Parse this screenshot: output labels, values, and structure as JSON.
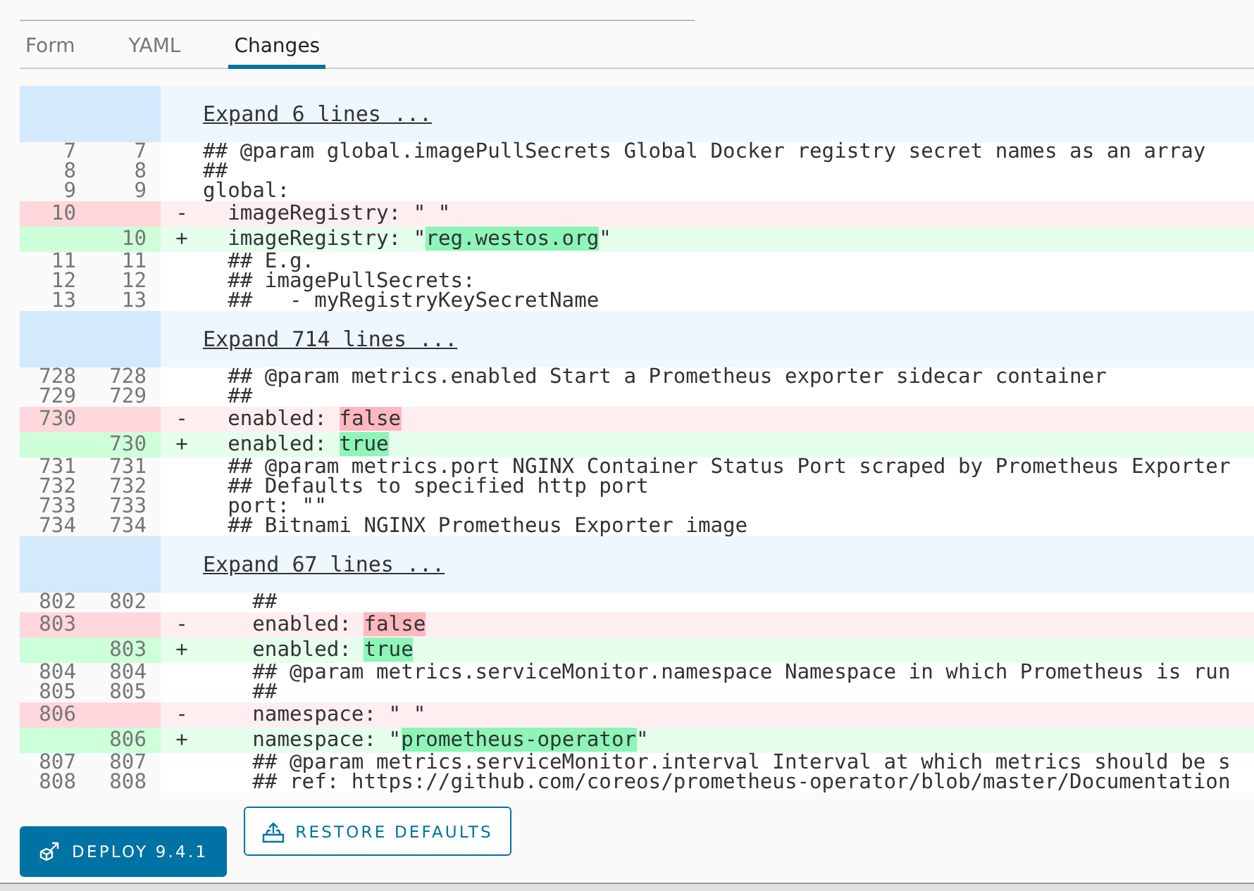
{
  "tabs": [
    {
      "label": "Form",
      "selected": false
    },
    {
      "label": "YAML",
      "selected": false
    },
    {
      "label": "Changes",
      "selected": true
    }
  ],
  "diff": {
    "rows": [
      {
        "kind": "expand",
        "label": "Expand 6 lines ..."
      },
      {
        "kind": "context",
        "old": "7",
        "new": "7",
        "parts": [
          {
            "text": "## @param global.imagePullSecrets Global Docker registry secret names as an array",
            "highlight": false
          }
        ]
      },
      {
        "kind": "context",
        "old": "8",
        "new": "8",
        "parts": [
          {
            "text": "##",
            "highlight": false
          }
        ]
      },
      {
        "kind": "context",
        "old": "9",
        "new": "9",
        "parts": [
          {
            "text": "global:",
            "highlight": false
          }
        ]
      },
      {
        "kind": "removed",
        "old": "10",
        "marker": "-",
        "parts": [
          {
            "text": "  imageRegistry: \" \"",
            "highlight": false
          }
        ]
      },
      {
        "kind": "added",
        "new": "10",
        "marker": "+",
        "parts": [
          {
            "text": "  imageRegistry: \"",
            "highlight": false
          },
          {
            "text": "reg.westos.org",
            "highlight": true
          },
          {
            "text": "\"",
            "highlight": false
          }
        ]
      },
      {
        "kind": "context",
        "old": "11",
        "new": "11",
        "parts": [
          {
            "text": "  ## E.g.",
            "highlight": false
          }
        ]
      },
      {
        "kind": "context",
        "old": "12",
        "new": "12",
        "parts": [
          {
            "text": "  ## imagePullSecrets:",
            "highlight": false
          }
        ]
      },
      {
        "kind": "context",
        "old": "13",
        "new": "13",
        "parts": [
          {
            "text": "  ##   - myRegistryKeySecretName",
            "highlight": false
          }
        ]
      },
      {
        "kind": "expand",
        "label": "Expand 714 lines ..."
      },
      {
        "kind": "context",
        "old": "728",
        "new": "728",
        "parts": [
          {
            "text": "  ## @param metrics.enabled Start a Prometheus exporter sidecar container",
            "highlight": false
          }
        ]
      },
      {
        "kind": "context",
        "old": "729",
        "new": "729",
        "parts": [
          {
            "text": "  ##",
            "highlight": false
          }
        ]
      },
      {
        "kind": "removed",
        "old": "730",
        "marker": "-",
        "parts": [
          {
            "text": "  enabled: ",
            "highlight": false
          },
          {
            "text": "false",
            "highlight": true
          }
        ]
      },
      {
        "kind": "added",
        "new": "730",
        "marker": "+",
        "parts": [
          {
            "text": "  enabled: ",
            "highlight": false
          },
          {
            "text": "true",
            "highlight": true
          }
        ]
      },
      {
        "kind": "context",
        "old": "731",
        "new": "731",
        "parts": [
          {
            "text": "  ## @param metrics.port NGINX Container Status Port scraped by Prometheus Exporter",
            "highlight": false
          }
        ]
      },
      {
        "kind": "context",
        "old": "732",
        "new": "732",
        "parts": [
          {
            "text": "  ## Defaults to specified http port",
            "highlight": false
          }
        ]
      },
      {
        "kind": "context",
        "old": "733",
        "new": "733",
        "parts": [
          {
            "text": "  port: \"\"",
            "highlight": false
          }
        ]
      },
      {
        "kind": "context",
        "old": "734",
        "new": "734",
        "parts": [
          {
            "text": "  ## Bitnami NGINX Prometheus Exporter image",
            "highlight": false
          }
        ]
      },
      {
        "kind": "expand",
        "label": "Expand 67 lines ..."
      },
      {
        "kind": "context",
        "old": "802",
        "new": "802",
        "parts": [
          {
            "text": "    ##",
            "highlight": false
          }
        ]
      },
      {
        "kind": "removed",
        "old": "803",
        "marker": "-",
        "parts": [
          {
            "text": "    enabled: ",
            "highlight": false
          },
          {
            "text": "false",
            "highlight": true
          }
        ]
      },
      {
        "kind": "added",
        "new": "803",
        "marker": "+",
        "parts": [
          {
            "text": "    enabled: ",
            "highlight": false
          },
          {
            "text": "true",
            "highlight": true
          }
        ]
      },
      {
        "kind": "context",
        "old": "804",
        "new": "804",
        "parts": [
          {
            "text": "    ## @param metrics.serviceMonitor.namespace Namespace in which Prometheus is run",
            "highlight": false
          }
        ]
      },
      {
        "kind": "context",
        "old": "805",
        "new": "805",
        "parts": [
          {
            "text": "    ##",
            "highlight": false
          }
        ]
      },
      {
        "kind": "removed",
        "old": "806",
        "marker": "-",
        "parts": [
          {
            "text": "    namespace: \" \"",
            "highlight": false
          }
        ]
      },
      {
        "kind": "added",
        "new": "806",
        "marker": "+",
        "parts": [
          {
            "text": "    namespace: \"",
            "highlight": false
          },
          {
            "text": "prometheus-operator",
            "highlight": true
          },
          {
            "text": "\"",
            "highlight": false
          }
        ]
      },
      {
        "kind": "context",
        "old": "807",
        "new": "807",
        "parts": [
          {
            "text": "    ## @param metrics.serviceMonitor.interval Interval at which metrics should be s",
            "highlight": false
          }
        ]
      },
      {
        "kind": "context",
        "old": "808",
        "new": "808",
        "parts": [
          {
            "text": "    ## ref: https://github.com/coreos/prometheus-operator/blob/master/Documentation",
            "highlight": false
          }
        ]
      }
    ]
  },
  "buttons": [
    {
      "kind": "primary",
      "label": "DEPLOY 9.4.1"
    },
    {
      "kind": "outline",
      "label": "RESTORE DEFAULTS"
    }
  ]
}
